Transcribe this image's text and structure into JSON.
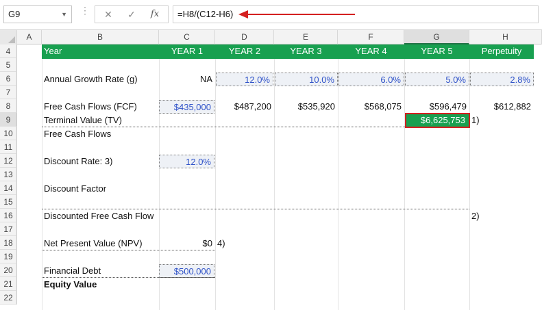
{
  "formula_bar": {
    "name_box": "G9",
    "formula": "=H8/(C12-H6)",
    "cancel_glyph": "✕",
    "enter_glyph": "✓",
    "fx_label": "fx"
  },
  "columns": [
    "A",
    "B",
    "C",
    "D",
    "E",
    "F",
    "G",
    "H"
  ],
  "rows": [
    "4",
    "5",
    "6",
    "7",
    "8",
    "9",
    "10",
    "11",
    "12",
    "13",
    "14",
    "15",
    "16",
    "17",
    "18",
    "19",
    "20",
    "21",
    "22"
  ],
  "header_row": {
    "label": "Year",
    "years": [
      "YEAR 1",
      "YEAR 2",
      "YEAR 3",
      "YEAR 4",
      "YEAR 5",
      "Perpetuity"
    ]
  },
  "growth": {
    "label": "Annual Growth Rate (g)",
    "values": [
      "NA",
      "12.0%",
      "10.0%",
      "6.0%",
      "5.0%",
      "2.8%"
    ]
  },
  "fcf": {
    "label": "Free Cash Flows (FCF)",
    "values": [
      "$435,000",
      "$487,200",
      "$535,920",
      "$568,075",
      "$596,479",
      "$612,882"
    ]
  },
  "terminal_value": {
    "label": "Terminal Value (TV)",
    "value": "$6,625,753",
    "note": "1)"
  },
  "free_cash_flows_label": "Free Cash Flows",
  "discount_rate": {
    "label": "Discount Rate: 3)",
    "value": "12.0%"
  },
  "discount_factor_label": "Discount Factor",
  "discounted_fcf": {
    "label": "Discounted Free Cash Flow",
    "note": "2)"
  },
  "npv": {
    "label": "Net Present Value (NPV)",
    "value": "$0",
    "note": "4)"
  },
  "financial_debt": {
    "label": "Financial Debt",
    "value": "$500,000"
  },
  "equity_value_label": "Equity Value",
  "colors": {
    "header_green": "#18a050",
    "highlight_red": "#d42020",
    "input_blue": "#2f52c8",
    "arrow_red": "#d42020"
  }
}
